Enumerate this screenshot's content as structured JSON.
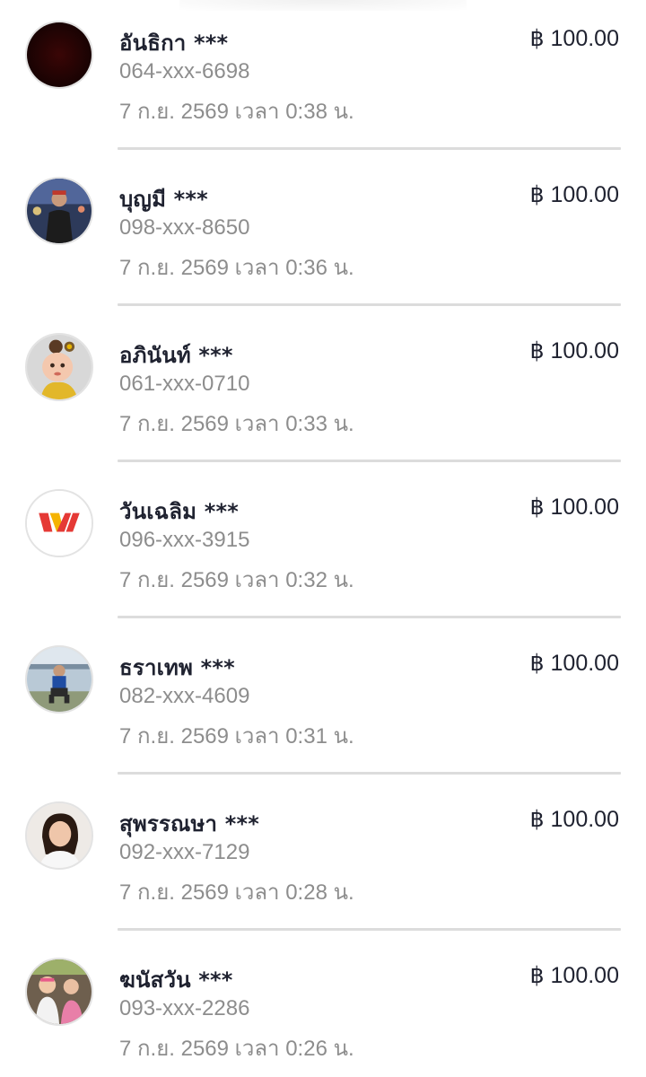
{
  "transactions": [
    {
      "name": "อันธิกา ***",
      "amount": "฿ 100.00",
      "phone": "064-xxx-6698",
      "datetime": "7 ก.ย. 2569 เวลา 0:38 น.",
      "avatar": "dark-red-circle-avatar"
    },
    {
      "name": "บุญมี ***",
      "amount": "฿ 100.00",
      "phone": "098-xxx-8650",
      "datetime": "7 ก.ย. 2569 เวลา 0:36 น.",
      "avatar": "man-photo-avatar"
    },
    {
      "name": "อภินันท์ ***",
      "amount": "฿ 100.00",
      "phone": "061-xxx-0710",
      "datetime": "7 ก.ย. 2569 เวลา 0:33 น.",
      "avatar": "cartoon-girl-avatar"
    },
    {
      "name": "วันเฉลิม ***",
      "amount": "฿ 100.00",
      "phone": "096-xxx-3915",
      "datetime": "7 ก.ย. 2569 เวลา 0:32 น.",
      "avatar": "w-logo-avatar"
    },
    {
      "name": "ธราเทพ ***",
      "amount": "฿ 100.00",
      "phone": "082-xxx-4609",
      "datetime": "7 ก.ย. 2569 เวลา 0:31 น.",
      "avatar": "boy-sitting-avatar"
    },
    {
      "name": "สุพรรณษา ***",
      "amount": "฿ 100.00",
      "phone": "092-xxx-7129",
      "datetime": "7 ก.ย. 2569 เวลา 0:28 น.",
      "avatar": "woman-photo-avatar"
    },
    {
      "name": "ฆนัสวัน ***",
      "amount": "฿ 100.00",
      "phone": "093-xxx-2286",
      "datetime": "7 ก.ย. 2569 เวลา 0:26 น.",
      "avatar": "children-photo-avatar"
    }
  ],
  "colors": {
    "text_primary": "#1f2230",
    "text_secondary": "#8d8d8d",
    "divider": "#dcdcdc",
    "w_logo_red": "#e53935",
    "w_logo_yellow": "#f5b301"
  }
}
